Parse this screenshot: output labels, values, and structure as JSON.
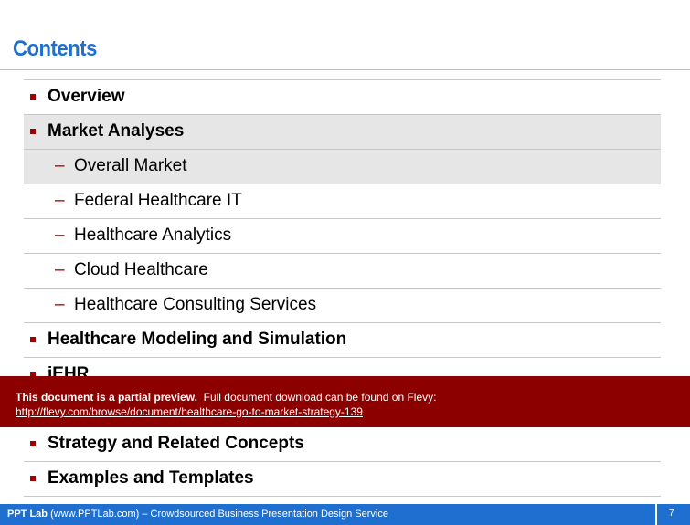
{
  "page": {
    "title": "Contents"
  },
  "toc": [
    {
      "level": 1,
      "text": "Overview",
      "highlighted": false
    },
    {
      "level": 1,
      "text": "Market Analyses",
      "highlighted": true
    },
    {
      "level": 2,
      "text": "Overall Market",
      "highlighted": true
    },
    {
      "level": 2,
      "text": "Federal Healthcare IT",
      "highlighted": false
    },
    {
      "level": 2,
      "text": "Healthcare Analytics",
      "highlighted": false
    },
    {
      "level": 2,
      "text": "Cloud Healthcare",
      "highlighted": false
    },
    {
      "level": 2,
      "text": "Healthcare Consulting Services",
      "highlighted": false
    },
    {
      "level": 1,
      "text": "Healthcare Modeling and Simulation",
      "highlighted": false
    },
    {
      "level": 1,
      "text": "iEHR",
      "highlighted": false
    },
    {
      "level": 1,
      "text": "",
      "highlighted": false
    },
    {
      "level": 1,
      "text": "Strategy and Related Concepts",
      "highlighted": false
    },
    {
      "level": 1,
      "text": "Examples and Templates",
      "highlighted": false
    }
  ],
  "banner": {
    "bold_text": "This document is a partial preview.",
    "text": "Full document download can be found on Flevy:",
    "link": "http://flevy.com/browse/document/healthcare-go-to-market-strategy-139"
  },
  "footer": {
    "brand": "PPT Lab",
    "text": "(www.PPTLab.com) – Crowdsourced Business Presentation Design Service",
    "page_number": "7"
  },
  "colors": {
    "title": "#1f6fd1",
    "bullet": "#a00000",
    "banner": "#8c0000",
    "footer": "#1f6fd1",
    "highlight": "#e6e6e6"
  }
}
